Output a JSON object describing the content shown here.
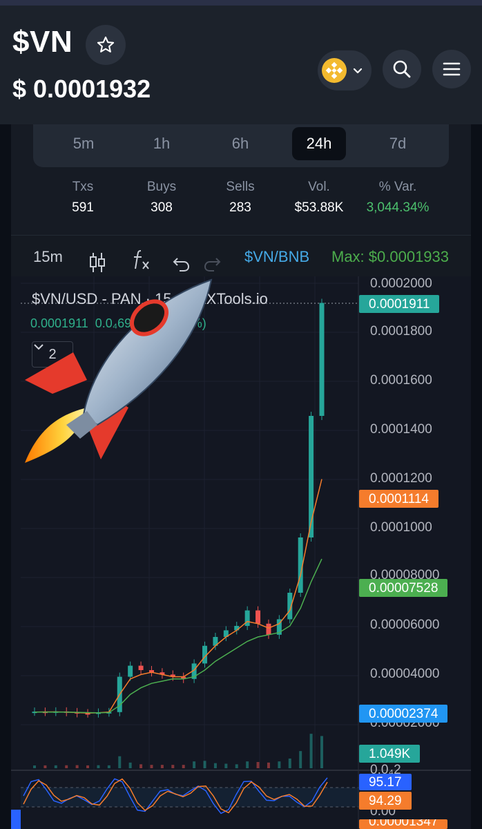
{
  "header": {
    "ticker": "$VN",
    "price": "$ 0.0001932",
    "icons": [
      "star-icon",
      "bnb-chain-icon",
      "chevron-down-icon",
      "search-icon",
      "menu-icon"
    ]
  },
  "timeframes": {
    "items": [
      "5m",
      "1h",
      "6h",
      "24h",
      "7d"
    ],
    "active": "24h"
  },
  "stats": {
    "txs_label": "Txs",
    "txs": "591",
    "buys_label": "Buys",
    "buys": "308",
    "sells_label": "Sells",
    "sells": "283",
    "vol_label": "Vol.",
    "vol": "$53.88K",
    "var_label": "% Var.",
    "var": "3,044.34%"
  },
  "toolbar": {
    "interval": "15m",
    "pair": "$VN/BNB",
    "max": "Max: $0.0001933",
    "icons": [
      "candles-icon",
      "indicators-icon",
      "undo-icon",
      "redo-icon"
    ]
  },
  "chart_overlay": {
    "title": "$VN/USD - PAN · 15 · DEXTools.io",
    "last": "0.0001911",
    "change": "0.0₄6930 (+56.89%)",
    "collapse_count": "2"
  },
  "colors": {
    "up": "#26a69a",
    "down": "#ef5350",
    "accent_green": "#4cc06d",
    "pair_blue": "#45a9e6",
    "bg": "#131722"
  },
  "chart_data": {
    "type": "line",
    "y_axis_ticks": [
      "0.0002000",
      "0.0001800",
      "0.0001600",
      "0.0001400",
      "0.0001200",
      "0.0001000",
      "0.00008000",
      "0.00006000",
      "0.00004000",
      "0.00002000"
    ],
    "ylim": [
      0,
      0.0002
    ],
    "price_tags": [
      {
        "label": "0.0001911",
        "color": "#26a69a"
      },
      {
        "label": "0.0001114",
        "color": "#f57c2c"
      },
      {
        "label": "0.00007528",
        "color": "#4caf50"
      },
      {
        "label": "0.00002374",
        "color": "#2196f3"
      }
    ],
    "volume_tag": "1.049K",
    "volume_zero": "0.0₄2",
    "oscillator_tags": [
      {
        "label": "95.17",
        "color": "#2962ff"
      },
      {
        "label": "94.29",
        "color": "#f57c2c"
      }
    ],
    "bottom_label": "0.00",
    "bottom_tag": "0.00001347",
    "series": [
      {
        "name": "price",
        "values": [
          6.2e-06,
          6.1e-06,
          6.3e-06,
          6e-06,
          5.5e-06,
          5.4e-06,
          5.8e-06,
          6e-06,
          2.2e-05,
          2.7e-05,
          2.5e-05,
          2.4e-05,
          2.3e-05,
          2.2e-05,
          2.1e-05,
          2.8e-05,
          3.6e-05,
          4e-05,
          4.3e-05,
          4.5e-05,
          5.2e-05,
          4.6e-05,
          4.1e-05,
          4.8e-05,
          6e-05,
          8.5e-05,
          0.00014,
          0.0001911
        ]
      },
      {
        "name": "ma_fast",
        "values": [
          6e-06,
          6.1e-06,
          6.1e-06,
          6e-06,
          5.8e-06,
          5.6e-06,
          5.7e-06,
          6e-06,
          1.4e-05,
          2.1e-05,
          2.3e-05,
          2.4e-05,
          2.3e-05,
          2.2e-05,
          2.2e-05,
          2.5e-05,
          3.1e-05,
          3.6e-05,
          4e-05,
          4.3e-05,
          4.7e-05,
          4.6e-05,
          4.4e-05,
          4.6e-05,
          5.2e-05,
          6.8e-05,
          9.2e-05,
          0.0001114
        ]
      },
      {
        "name": "ma_slow",
        "values": [
          6e-06,
          6e-06,
          6e-06,
          6e-06,
          5.9e-06,
          5.8e-06,
          5.7e-06,
          5.8e-06,
          9e-06,
          1.4e-05,
          1.7e-05,
          1.9e-05,
          2e-05,
          2.1e-05,
          2.1e-05,
          2.2e-05,
          2.5e-05,
          2.9e-05,
          3.2e-05,
          3.5e-05,
          3.8e-05,
          4e-05,
          4.1e-05,
          4.2e-05,
          4.5e-05,
          5.3e-05,
          6.5e-05,
          7.528e-05
        ]
      }
    ]
  }
}
